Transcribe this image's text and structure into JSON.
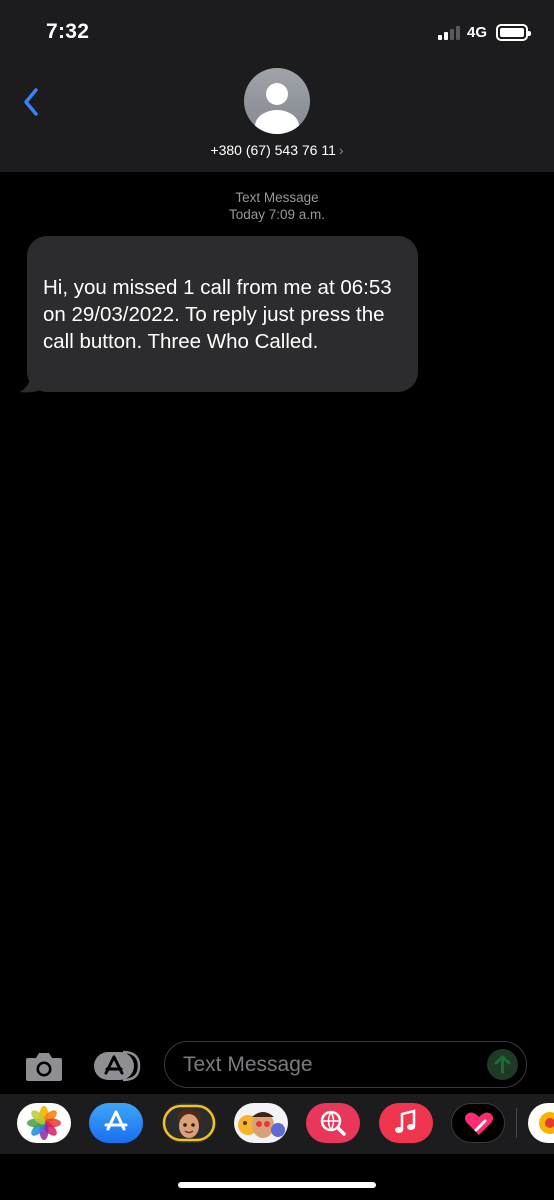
{
  "status_bar": {
    "time": "7:32",
    "network": "4G"
  },
  "header": {
    "contact_number": "+380 (67) 543 76 11",
    "contact_chevron": "›"
  },
  "conversation": {
    "message_kind": "Text Message",
    "timestamp": "Today 7:09 a.m.",
    "message_text": "Hi, you missed 1 call from me at 06:53 on 29/03/2022. To reply just press the call button.  Three Who Called."
  },
  "composer": {
    "placeholder": "Text Message"
  },
  "app_drawer": {
    "apps": [
      "photos-icon",
      "app-store-icon",
      "memoji-icon",
      "animoji-stickers-icon",
      "web-search-icon",
      "music-icon",
      "digital-touch-icon",
      "more-apps-icon"
    ]
  },
  "colors": {
    "accent_blue": "#3a82f7",
    "bubble_gray": "#2c2c2e",
    "bar_background": "#1c1c1e",
    "send_button_disabled": "#1e3a26"
  }
}
